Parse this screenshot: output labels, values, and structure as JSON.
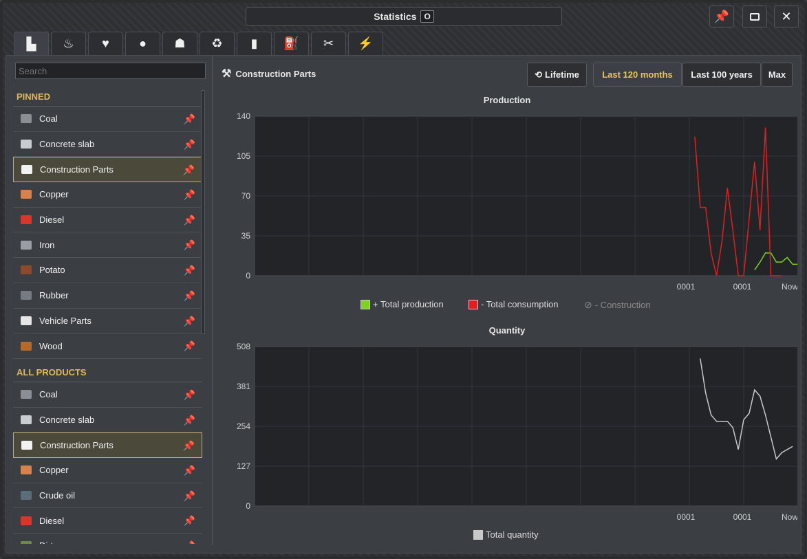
{
  "window": {
    "title": "Statistics",
    "badge": "O"
  },
  "window_buttons": {
    "pin": "pin-icon",
    "maximize": "maximize-icon",
    "close": "close-icon"
  },
  "tabs": [
    {
      "icon": "factory-icon",
      "glyph": "▙"
    },
    {
      "icon": "food-bowl-icon",
      "glyph": "♨"
    },
    {
      "icon": "health-heart-icon",
      "glyph": "♥"
    },
    {
      "icon": "population-icon",
      "glyph": "●"
    },
    {
      "icon": "worker-icon",
      "glyph": "☗"
    },
    {
      "icon": "recycling-icon",
      "glyph": "♻"
    },
    {
      "icon": "pollution-icon",
      "glyph": "▮"
    },
    {
      "icon": "fuel-icon",
      "glyph": "⛽"
    },
    {
      "icon": "maintenance-icon",
      "glyph": "✂"
    },
    {
      "icon": "electricity-icon",
      "glyph": "⚡"
    }
  ],
  "search": {
    "placeholder": "Search"
  },
  "sidebar": {
    "pinned_header": "PINNED",
    "pinned": [
      {
        "label": "Coal",
        "icon": "coal-icon",
        "color": "#8a8f96"
      },
      {
        "label": "Concrete slab",
        "icon": "concrete-slab-icon",
        "color": "#c9ccd0"
      },
      {
        "label": "Construction Parts",
        "icon": "construction-parts-icon",
        "color": "#f2f2f2"
      },
      {
        "label": "Copper",
        "icon": "copper-icon",
        "color": "#d6824c"
      },
      {
        "label": "Diesel",
        "icon": "diesel-icon",
        "color": "#d9362b"
      },
      {
        "label": "Iron",
        "icon": "iron-icon",
        "color": "#9a9ea4"
      },
      {
        "label": "Potato",
        "icon": "potato-icon",
        "color": "#8b4a2a"
      },
      {
        "label": "Rubber",
        "icon": "rubber-icon",
        "color": "#777b82"
      },
      {
        "label": "Vehicle Parts",
        "icon": "vehicle-parts-icon",
        "color": "#e6e6e6"
      },
      {
        "label": "Wood",
        "icon": "wood-icon",
        "color": "#b36a2a"
      }
    ],
    "all_header": "ALL PRODUCTS",
    "all": [
      {
        "label": "Coal",
        "icon": "coal-icon",
        "color": "#8a8f96"
      },
      {
        "label": "Concrete slab",
        "icon": "concrete-slab-icon",
        "color": "#c9ccd0"
      },
      {
        "label": "Construction Parts",
        "icon": "construction-parts-icon",
        "color": "#f2f2f2"
      },
      {
        "label": "Copper",
        "icon": "copper-icon",
        "color": "#d6824c"
      },
      {
        "label": "Crude oil",
        "icon": "crude-oil-icon",
        "color": "#5a6e7a"
      },
      {
        "label": "Diesel",
        "icon": "diesel-icon",
        "color": "#d9362b"
      },
      {
        "label": "Dirt",
        "icon": "dirt-icon",
        "color": "#6b8a4a"
      }
    ]
  },
  "product": {
    "title": "Construction Parts"
  },
  "range_buttons": {
    "lifetime": "Lifetime",
    "last120": "Last 120 months",
    "last100": "Last 100 years",
    "max": "Max"
  },
  "colors": {
    "accent": "#e8c65a",
    "production": "#7ed321",
    "consumption": "#e02020",
    "quantity": "#c8c8c8"
  },
  "chart_data": [
    {
      "type": "line",
      "title": "Production",
      "ylim": [
        0,
        140
      ],
      "yticks": [
        0,
        35,
        70,
        105,
        140
      ],
      "xtick_labels": [
        "0001",
        "0001",
        "Now"
      ],
      "grid": true,
      "legend": [
        "+ Total production",
        "- Total consumption",
        "- Construction"
      ],
      "series": [
        {
          "name": "+ Total production",
          "color": "#7ed321",
          "values": [
            [
              112,
              5
            ],
            [
              113,
              12
            ],
            [
              114,
              20
            ],
            [
              115,
              20
            ],
            [
              116,
              12
            ],
            [
              117,
              12
            ],
            [
              118,
              16
            ],
            [
              119,
              10
            ],
            [
              120,
              10
            ]
          ]
        },
        {
          "name": "- Total consumption",
          "color": "#e02020",
          "values": [
            [
              101,
              122
            ],
            [
              102,
              60
            ],
            [
              103,
              60
            ],
            [
              104,
              20
            ],
            [
              105,
              0
            ],
            [
              106,
              30
            ],
            [
              107,
              77
            ],
            [
              108,
              40
            ],
            [
              109,
              0
            ],
            [
              110,
              0
            ],
            [
              111,
              50
            ],
            [
              112,
              100
            ],
            [
              113,
              40
            ],
            [
              114,
              130
            ],
            [
              115,
              0
            ],
            [
              116,
              0
            ],
            [
              117,
              0
            ]
          ]
        }
      ]
    },
    {
      "type": "line",
      "title": "Quantity",
      "ylim": [
        0,
        508
      ],
      "yticks": [
        0,
        127,
        254,
        381,
        508
      ],
      "xtick_labels": [
        "0001",
        "0001",
        "Now"
      ],
      "grid": true,
      "legend": [
        "Total quantity"
      ],
      "series": [
        {
          "name": "Total quantity",
          "color": "#c8c8c8",
          "values": [
            [
              102,
              470
            ],
            [
              103,
              360
            ],
            [
              104,
              290
            ],
            [
              105,
              270
            ],
            [
              106,
              270
            ],
            [
              107,
              270
            ],
            [
              108,
              250
            ],
            [
              109,
              180
            ],
            [
              110,
              275
            ],
            [
              111,
              295
            ],
            [
              112,
              370
            ],
            [
              113,
              350
            ],
            [
              114,
              290
            ],
            [
              115,
              220
            ],
            [
              116,
              150
            ],
            [
              117,
              170
            ],
            [
              118,
              180
            ],
            [
              119,
              190
            ]
          ]
        }
      ]
    }
  ]
}
